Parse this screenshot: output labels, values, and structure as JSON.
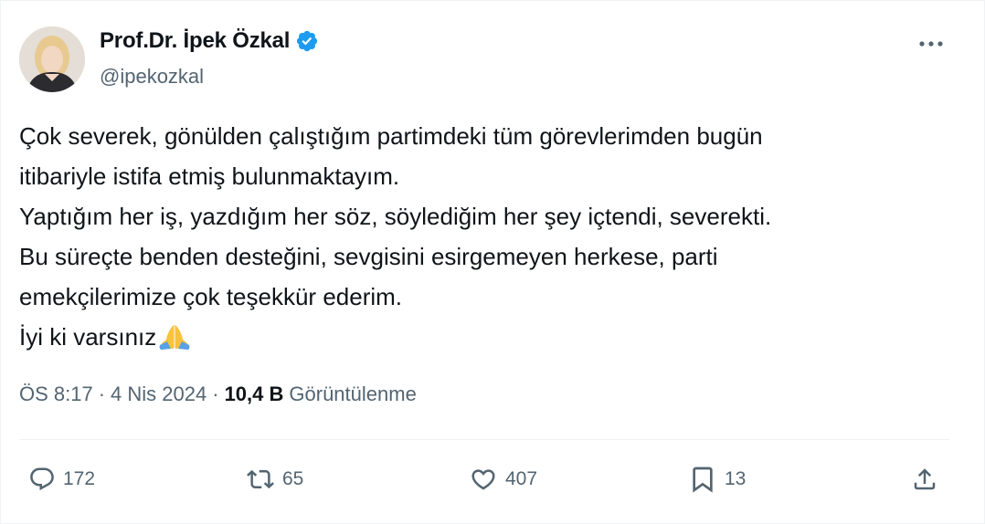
{
  "author": {
    "display_name": "Prof.Dr. İpek Özkal",
    "handle": "@ipekozkal",
    "verified": true
  },
  "tweet": {
    "lines": [
      "Çok severek, gönülden çalıştığım partimdeki tüm görevlerimden bugün",
      "itibariyle istifa etmiş bulunmaktayım.",
      "Yaptığım her iş, yazdığım her söz, söylediğim her şey içtendi, severekti.",
      "Bu süreçte benden desteğini, sevgisini esirgemeyen herkese, parti",
      "emekçilerimize çok teşekkür ederim.",
      "İyi ki varsınız"
    ],
    "emoji": "folded-hands"
  },
  "meta": {
    "time": "ÖS 8:17",
    "separator": "·",
    "date": "4 Nis 2024",
    "views_count": "10,4 B",
    "views_label": "Görüntülenme"
  },
  "actions": {
    "replies": "172",
    "reposts": "65",
    "likes": "407",
    "bookmarks": "13"
  },
  "icons": {
    "verified": "verified-badge-icon",
    "more": "more-options-icon",
    "reply": "reply-icon",
    "repost": "repost-icon",
    "like": "heart-icon",
    "bookmark": "bookmark-icon",
    "share": "share-icon"
  },
  "colors": {
    "text_primary": "#0f1419",
    "text_secondary": "#536471",
    "verified_blue": "#1d9bf0",
    "divider": "#eff3f4"
  }
}
